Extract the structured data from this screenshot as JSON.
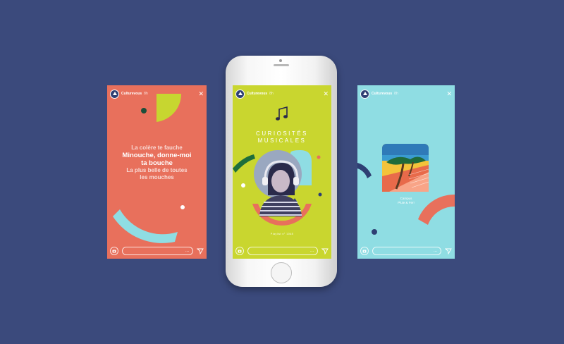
{
  "background_color": "#3b4a7c",
  "stories": {
    "left": {
      "username": "Culturevous",
      "time": "8h",
      "bg_color": "#e8705c",
      "poem": [
        "La colère te fauche",
        "Minouche, donne-moi",
        "ta bouche",
        "La plus belle de toutes",
        "les mouches"
      ],
      "more": "..."
    },
    "middle": {
      "username": "Culturevous",
      "time": "8h",
      "bg_color": "#c9d62f",
      "title_line1": "CURIOSITÉS",
      "title_line2": "MUSICALES",
      "caption": "Playlist n° 1048",
      "more": "..."
    },
    "right": {
      "username": "Culturevous",
      "time": "8h",
      "bg_color": "#8fdde3",
      "album_line1": "Campus",
      "album_line2": "Pluie & Fer!",
      "more": "..."
    }
  },
  "icons": [
    "close-icon",
    "camera-icon",
    "send-icon",
    "music-note-icon",
    "avatar-logo-icon"
  ]
}
